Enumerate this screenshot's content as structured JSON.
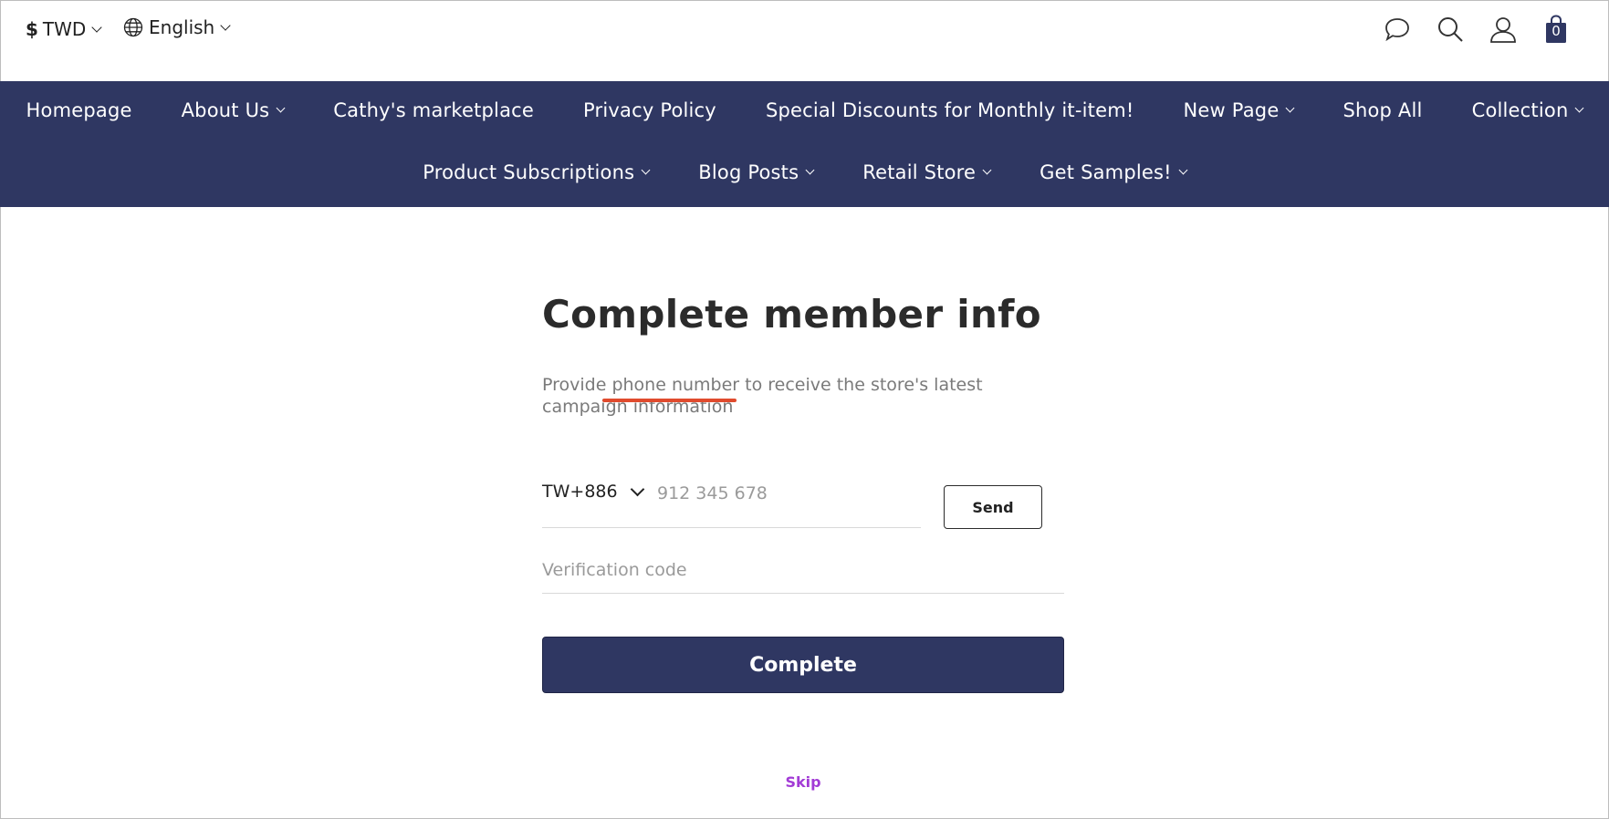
{
  "topbar": {
    "currency_symbol": "$",
    "currency_label": "TWD",
    "language_label": "English",
    "cart_count": "0",
    "icons": [
      "chat-icon",
      "search-icon",
      "user-icon",
      "cart-icon"
    ]
  },
  "nav": {
    "row1": [
      {
        "label": "Homepage",
        "dropdown": false
      },
      {
        "label": "About Us",
        "dropdown": true
      },
      {
        "label": "Cathy's marketplace",
        "dropdown": false
      },
      {
        "label": "Privacy Policy",
        "dropdown": false
      },
      {
        "label": "Special Discounts for Monthly it-item!",
        "dropdown": false
      },
      {
        "label": "New Page",
        "dropdown": true
      },
      {
        "label": "Shop All",
        "dropdown": false
      },
      {
        "label": "Collection",
        "dropdown": true
      }
    ],
    "row2": [
      {
        "label": "Product Subscriptions",
        "dropdown": true
      },
      {
        "label": "Blog Posts",
        "dropdown": true
      },
      {
        "label": "Retail Store",
        "dropdown": true
      },
      {
        "label": "Get Samples!",
        "dropdown": true
      }
    ]
  },
  "form": {
    "title": "Complete member info",
    "description": "Provide phone number to receive the store's latest campaign information",
    "country_code": "TW+886",
    "phone_placeholder": "912 345 678",
    "phone_value": "",
    "send_label": "Send",
    "code_placeholder": "Verification code",
    "code_value": "",
    "complete_label": "Complete",
    "skip_label": "Skip"
  },
  "colors": {
    "nav_bg": "#2f3762",
    "button_bg": "#2f3762",
    "skip_link": "#a23bd6",
    "annotation_underline": "#e04b2e"
  }
}
